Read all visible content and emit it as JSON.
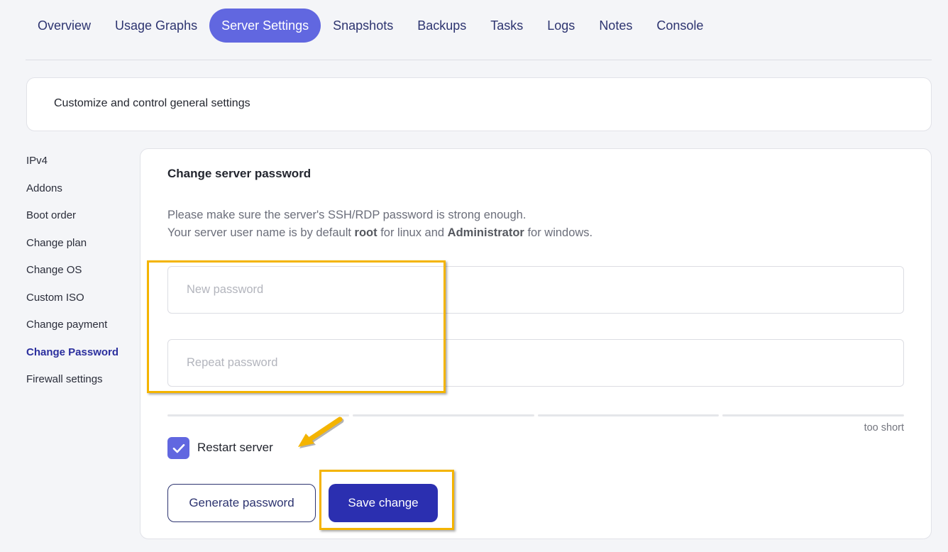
{
  "tabs": [
    {
      "label": "Overview",
      "active": false
    },
    {
      "label": "Usage Graphs",
      "active": false
    },
    {
      "label": "Server Settings",
      "active": true
    },
    {
      "label": "Snapshots",
      "active": false
    },
    {
      "label": "Backups",
      "active": false
    },
    {
      "label": "Tasks",
      "active": false
    },
    {
      "label": "Logs",
      "active": false
    },
    {
      "label": "Notes",
      "active": false
    },
    {
      "label": "Console",
      "active": false
    }
  ],
  "intro": {
    "text": "Customize and control general settings"
  },
  "sidebar": {
    "items": [
      {
        "label": "IPv4"
      },
      {
        "label": "Addons"
      },
      {
        "label": "Boot order"
      },
      {
        "label": "Change plan"
      },
      {
        "label": "Change OS"
      },
      {
        "label": "Custom ISO"
      },
      {
        "label": "Change payment"
      },
      {
        "label": "Change Password",
        "active": true
      },
      {
        "label": "Firewall settings"
      }
    ]
  },
  "panel": {
    "title": "Change server password",
    "desc_line1": "Please make sure the server's SSH/RDP password is strong enough.",
    "desc_line2_pre": "Your server user name is by default ",
    "desc_line2_root": "root",
    "desc_line2_mid": " for linux and ",
    "desc_line2_admin": "Administrator",
    "desc_line2_post": " for windows.",
    "new_password_placeholder": "New password",
    "repeat_password_placeholder": "Repeat password",
    "new_password_value": "",
    "repeat_password_value": "",
    "strength_label": "too short",
    "restart_label": "Restart server",
    "restart_checked": true,
    "generate_label": "Generate password",
    "save_label": "Save change"
  },
  "colors": {
    "accent": "#6167e0",
    "primary_button": "#2b2fb0",
    "nav_text": "#2d3470",
    "highlight": "#f4b400"
  },
  "icons": {
    "checkbox": "check-icon",
    "annotation": "arrow-icon"
  }
}
